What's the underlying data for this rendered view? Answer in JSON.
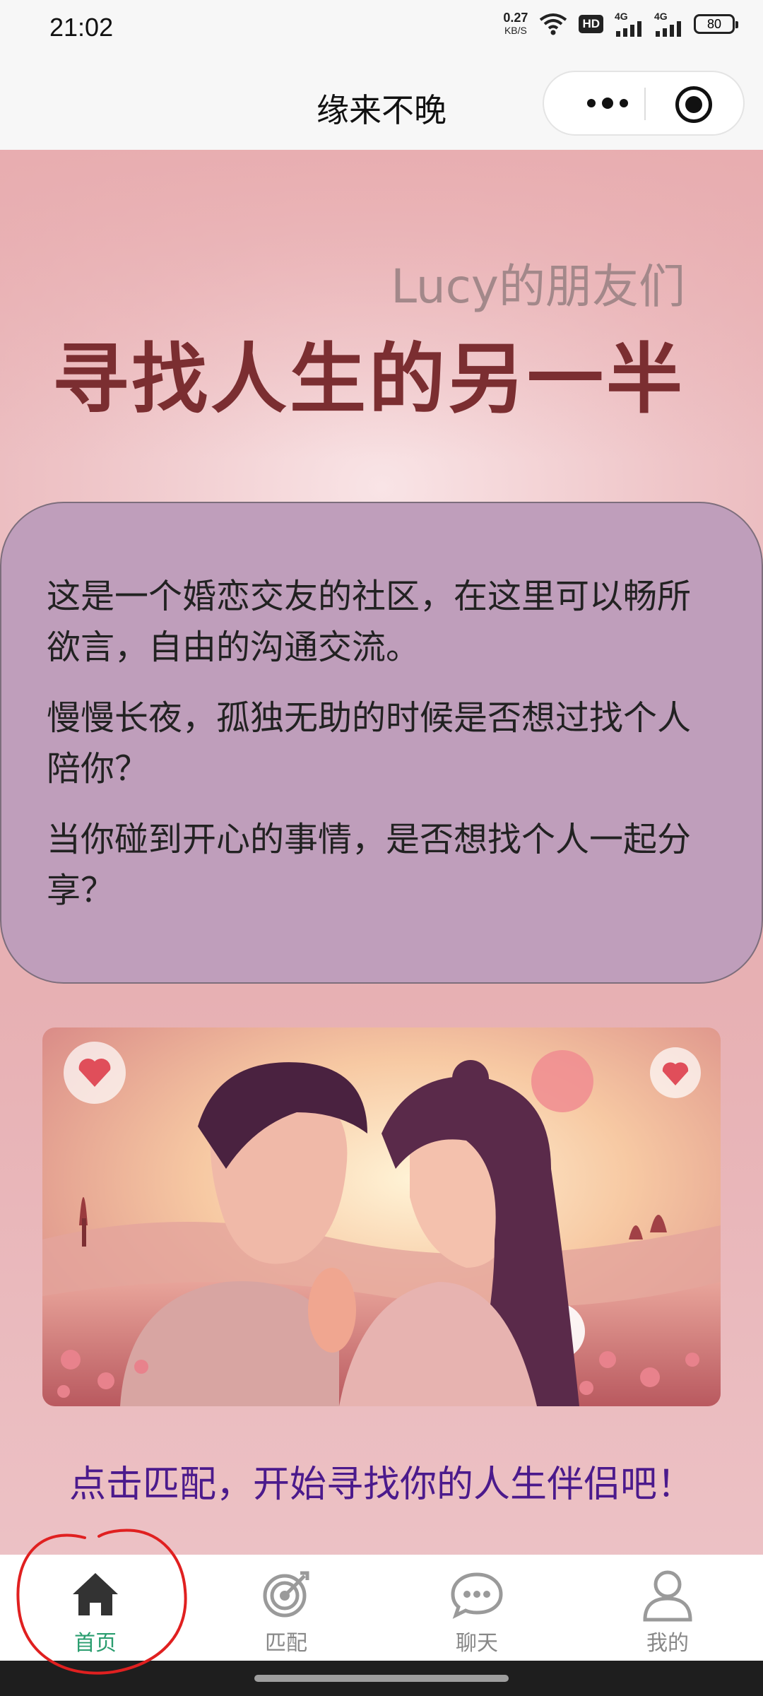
{
  "status_bar": {
    "time": "21:02",
    "net_speed_value": "0.27",
    "net_speed_unit": "KB/S",
    "hd_label": "HD",
    "sim1_label": "4G",
    "sim2_label": "4G",
    "battery": "80"
  },
  "nav": {
    "title": "缘来不晚"
  },
  "hero_text": {
    "subtitle": "Lucy的朋友们",
    "headline": "寻找人生的另一半"
  },
  "intro": {
    "paragraphs": [
      "这是一个婚恋交友的社区，在这里可以畅所欲言，自由的沟通交流。",
      "慢慢长夜，孤独无助的时候是否想过找个人陪你？",
      "当你碰到开心的事情，是否想找个人一起分享？"
    ]
  },
  "cta": "点击匹配，开始寻找你的人生伴侣吧！",
  "tabs": [
    {
      "label": "首页",
      "icon": "home-icon",
      "active": true
    },
    {
      "label": "匹配",
      "icon": "target-icon",
      "active": false
    },
    {
      "label": "聊天",
      "icon": "chat-icon",
      "active": false
    },
    {
      "label": "我的",
      "icon": "user-icon",
      "active": false
    }
  ],
  "colors": {
    "headline": "#7b2e31",
    "card": "#bf9ebb",
    "cta": "#4b1a8c",
    "tab_active": "#2a9d6f",
    "annotation": "#e02020"
  }
}
